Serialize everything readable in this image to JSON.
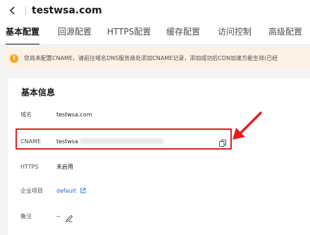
{
  "header": {
    "title": "testwsa.com"
  },
  "tabs": [
    {
      "label": "基本配置",
      "active": true
    },
    {
      "label": "回源配置",
      "active": false
    },
    {
      "label": "HTTPS配置",
      "active": false
    },
    {
      "label": "缓存配置",
      "active": false
    },
    {
      "label": "访问控制",
      "active": false
    },
    {
      "label": "高级配置",
      "active": false
    }
  ],
  "alert": {
    "icon": "warning-icon",
    "text": "您尚未配置CNAME，请前往域名DNS服务商处添加CNAME记录，添加成功后CDN加速方能生效(已经"
  },
  "basic_info": {
    "title": "基本信息",
    "rows": {
      "domain": {
        "label": "域名",
        "value": "testwsa.com"
      },
      "cname": {
        "label": "CNAME",
        "value": "testwsa"
      },
      "https": {
        "label": "HTTPS",
        "value": "未启用"
      },
      "project": {
        "label": "企业项目",
        "value": "default"
      },
      "remark": {
        "label": "备注",
        "value": "--"
      }
    }
  },
  "colors": {
    "accent": "#1a6fd8",
    "highlight": "#e02020",
    "alert_bg": "#fdf1e3",
    "alert_icon": "#f5a623"
  }
}
